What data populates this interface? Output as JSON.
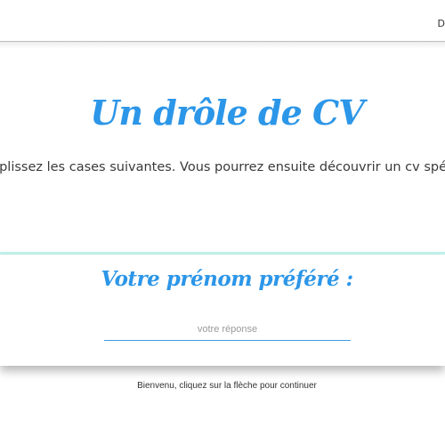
{
  "header": {
    "corner_text": "D"
  },
  "intro": {
    "title": "Un drôle de CV",
    "description": "Remplissez les cases suivantes. Vous pourrez ensuite découvrir un cv spécial !"
  },
  "question": {
    "label": "Votre prénom préféré :",
    "placeholder": "votre réponse",
    "value": ""
  },
  "footer": {
    "hint": "Bienvenu, cliquez sur la flèche pour continuer"
  },
  "colors": {
    "accent": "#2c96e8",
    "input_underline": "#3a9be6",
    "separator": "#bff3ea"
  }
}
